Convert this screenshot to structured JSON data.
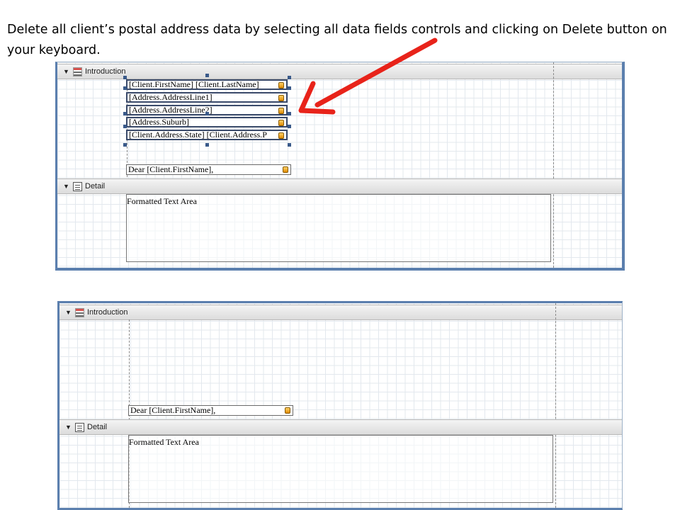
{
  "instruction": {
    "text": "Delete all client’s postal address data  by selecting all data fields controls and clicking on Delete button on your keyboard."
  },
  "before": {
    "band_intro_label": "Introduction",
    "band_detail_label": "Detail",
    "fields": [
      "[Client.FirstName] [Client.LastName]",
      "[Address.AddressLine1]",
      "[Address.AddressLine2]",
      "[Address.Suburb]",
      "[Client.Address.State]  [Client.Address.P"
    ],
    "greeting_field": "Dear [Client.FirstName],",
    "textarea_label": "Formatted Text Area"
  },
  "after": {
    "band_intro_label": "Introduction",
    "band_detail_label": "Detail",
    "greeting_field": "Dear [Client.FirstName],",
    "textarea_label": "Formatted Text Area"
  },
  "colors": {
    "arrow": "#e8231a",
    "frame": "#5b7fae",
    "selection": "#3a5a8a"
  },
  "icons": {
    "band_toggle": "collapse-triangle-icon",
    "intro_band": "report-header-icon",
    "detail_band": "detail-band-icon",
    "field_data": "database-field-icon"
  }
}
